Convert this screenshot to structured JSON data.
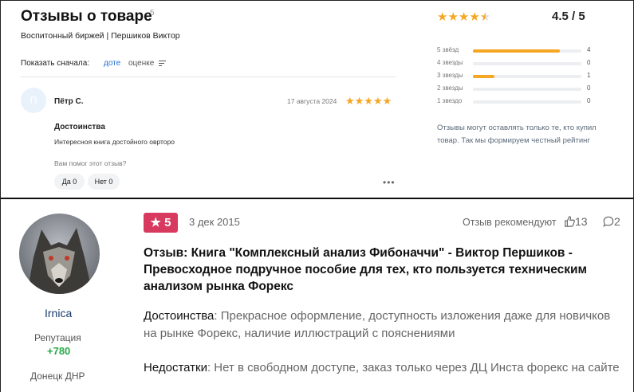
{
  "product_reviews": {
    "title": "Отзывы о товаре",
    "count": "5",
    "subtitle": "Воспитонный биржей | Першиков Виктор",
    "sort": {
      "label": "Показать сначала:",
      "by_date": "доте",
      "by_rating": "оценке"
    },
    "rating": {
      "stars": "★★★★★",
      "value": "4.5 / 5"
    },
    "distribution": [
      {
        "label": "5 звёзд",
        "count": "4",
        "fraction": 0.8
      },
      {
        "label": "4 звезды",
        "count": "0",
        "fraction": 0
      },
      {
        "label": "3 звезды",
        "count": "1",
        "fraction": 0.2
      },
      {
        "label": "2 звезды",
        "count": "0",
        "fraction": 0
      },
      {
        "label": "1 звездо",
        "count": "0",
        "fraction": 0
      }
    ],
    "note": "Отзывы могут оставлять только те, кто купил товар. Так мы формируем честный рейтинг",
    "review": {
      "avatar_letter": "П",
      "author": "Пётр С.",
      "date": "17 августа 2024",
      "stars": "★★★★★",
      "section_title": "Достоинства",
      "section_text": "Интересноя книга достойного оврторо",
      "helpful_question": "Вам помог этот отзыв?",
      "yes": "Да 0",
      "no": "Нет 0",
      "more": "•••"
    }
  },
  "forum_review": {
    "username": "Irnica",
    "reputation_label": "Репутация",
    "reputation_value": "+780",
    "location": "Донецк ДНР",
    "badge_score": "5",
    "date": "3 дек 2015",
    "recommend_label": "Отзыв рекомендуют",
    "likes": "13",
    "comments": "2",
    "title": "Отзыв: Книга \"Комплексный анализ Фибоначчи\" - Виктор Першиков - Превосходное подручное пособие для тех, кто пользуется техническим анализом рынка Форекс",
    "pros_label": "Достоинства",
    "pros_text": ": Прекрасное оформление, доступность изложения даже для новичков на рынке Форекс, наличие иллюстраций с пояснениями",
    "cons_label": "Недостатки",
    "cons_text": ": Нет в свободном доступе, заказ только через ДЦ Инста форекс на сайте"
  },
  "colors": {
    "star": "#f5a623",
    "link": "#1f6fd1",
    "badge": "#d83a5f",
    "reputation": "#2aa84a"
  }
}
